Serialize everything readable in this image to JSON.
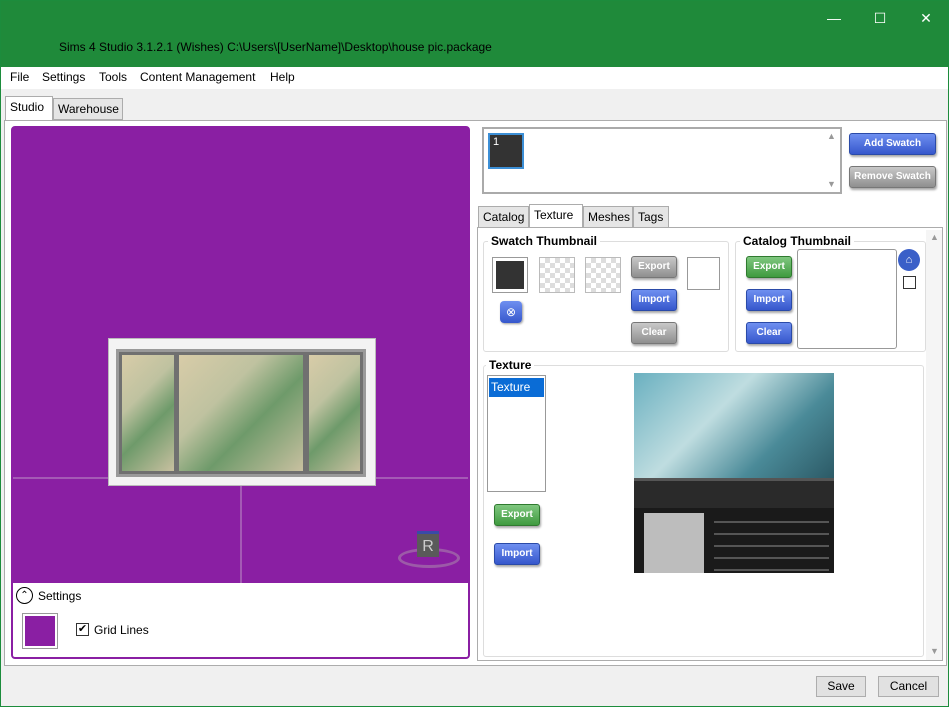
{
  "titlebar": {
    "title": "Sims 4 Studio 3.1.2.1 (Wishes)  C:\\Users\\[UserName]\\Desktop\\house pic.package",
    "minimize": "—",
    "maximize": "☐",
    "close": "✕"
  },
  "menu": [
    "File",
    "Settings",
    "Tools",
    "Content Management",
    "Help"
  ],
  "main_tabs": [
    {
      "label": "Studio",
      "active": true
    },
    {
      "label": "Warehouse",
      "active": false
    }
  ],
  "viewport": {
    "background_color": "#8a1fa3",
    "rotate_badge": "R",
    "settings": {
      "label": "Settings",
      "swatch_color": "#8a1fa3",
      "grid_lines_label": "Grid Lines",
      "grid_lines_checked": true
    }
  },
  "swatches": {
    "items": [
      {
        "label": "1",
        "selected": true
      }
    ],
    "add_label": "Add Swatch",
    "remove_label": "Remove Swatch"
  },
  "sub_tabs": [
    {
      "label": "Catalog",
      "active": false
    },
    {
      "label": "Texture",
      "active": true
    },
    {
      "label": "Meshes",
      "active": false
    },
    {
      "label": "Tags",
      "active": false
    }
  ],
  "swatch_thumbnail": {
    "title": "Swatch Thumbnail",
    "export_label": "Export",
    "import_label": "Import",
    "clear_label": "Clear",
    "remove_icon": "⊗"
  },
  "catalog_thumbnail": {
    "title": "Catalog Thumbnail",
    "export_label": "Export",
    "import_label": "Import",
    "clear_label": "Clear",
    "house_icon": "⌂",
    "checkbox_checked": false
  },
  "texture": {
    "title": "Texture",
    "list_items": [
      "Texture"
    ],
    "export_label": "Export",
    "import_label": "Import"
  },
  "footer": {
    "save_label": "Save",
    "cancel_label": "Cancel"
  }
}
